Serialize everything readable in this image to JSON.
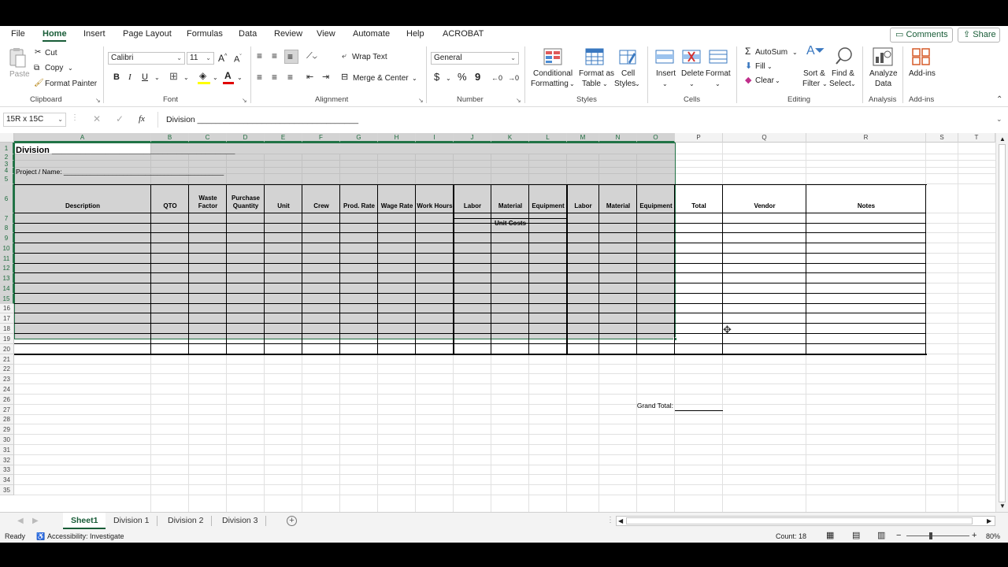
{
  "menu": {
    "items": [
      "File",
      "Home",
      "Insert",
      "Page Layout",
      "Formulas",
      "Data",
      "Review",
      "View",
      "Automate",
      "Help",
      "ACROBAT"
    ],
    "active": "Home",
    "comments_label": "Comments",
    "share_label": "Share"
  },
  "ribbon": {
    "clipboard": {
      "paste": "Paste",
      "cut": "Cut",
      "copy": "Copy",
      "format_painter": "Format Painter",
      "group": "Clipboard"
    },
    "font": {
      "name": "Calibri",
      "size": "11",
      "group": "Font"
    },
    "alignment": {
      "wrap_text": "Wrap Text",
      "merge_center": "Merge & Center",
      "group": "Alignment"
    },
    "number": {
      "format": "General",
      "group": "Number"
    },
    "styles": {
      "conditional": "Conditional",
      "formatting": "Formatting",
      "format_as": "Format as",
      "table": "Table",
      "cell": "Cell",
      "cell_styles": "Styles",
      "group": "Styles"
    },
    "cells": {
      "insert": "Insert",
      "delete": "Delete",
      "format": "Format",
      "group": "Cells"
    },
    "editing": {
      "autosum": "AutoSum",
      "fill": "Fill",
      "clear": "Clear",
      "sort": "Sort &",
      "filter": "Filter",
      "find": "Find &",
      "select": "Select",
      "group": "Editing"
    },
    "analysis": {
      "analyze": "Analyze",
      "data": "Data",
      "group": "Analysis"
    },
    "addins": {
      "label": "Add-ins",
      "group": "Add-ins"
    }
  },
  "formula_bar": {
    "name_box": "15R x 15C",
    "formula": "Division ___________________________________"
  },
  "grid": {
    "columns": [
      "A",
      "B",
      "C",
      "D",
      "E",
      "F",
      "G",
      "H",
      "I",
      "J",
      "K",
      "L",
      "M",
      "N",
      "O",
      "P",
      "Q",
      "R",
      "S",
      "T"
    ],
    "rows": [
      "1",
      "2",
      "3",
      "4",
      "5",
      "6",
      "7",
      "8",
      "9",
      "10",
      "11",
      "12",
      "13",
      "14",
      "15",
      "16",
      "17",
      "18",
      "19",
      "20",
      "21",
      "22",
      "23",
      "24",
      "26",
      "27",
      "28",
      "29",
      "30",
      "31",
      "32",
      "33",
      "34",
      "35"
    ],
    "division_label": "Division ______________________________________",
    "project_label": "Project / Name: ___________________________________________",
    "unit_costs": "Unit Costs",
    "headers": [
      "Description",
      "QTO",
      "Waste Factor",
      "Purchase Quantity",
      "Unit",
      "Crew",
      "Prod. Rate",
      "Wage Rate",
      "Work Hours",
      "Labor",
      "Material",
      "Equipment",
      "Labor",
      "Material",
      "Equipment",
      "Total",
      "Vendor",
      "Notes"
    ],
    "grand_total_label": "Grand Total:"
  },
  "sheets": {
    "tabs": [
      "Sheet1",
      "Division 1",
      "Division 2",
      "Division 3"
    ],
    "active": "Sheet1"
  },
  "status": {
    "ready": "Ready",
    "accessibility": "Accessibility: Investigate",
    "count": "Count: 18",
    "zoom": "80%"
  }
}
